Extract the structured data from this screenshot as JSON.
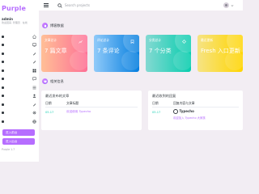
{
  "sidebar": {
    "brand": "Purple",
    "profile": {
      "name": "admin",
      "meta": "欢迎回来, 管理员 · 在线"
    },
    "nav_items": [
      {
        "icon": "home-icon"
      },
      {
        "icon": "monitor-icon"
      },
      {
        "icon": "pen-icon"
      },
      {
        "icon": "pen-icon"
      },
      {
        "icon": "grid-icon"
      },
      {
        "icon": "comment-icon"
      },
      {
        "icon": "list-icon"
      },
      {
        "icon": "user-icon"
      },
      {
        "icon": "pen-icon"
      },
      {
        "icon": "settings-icon"
      },
      {
        "icon": "globe-icon"
      }
    ],
    "button_1": "进入前台",
    "button_2": "进入后台",
    "footer": "Purple 1.7"
  },
  "topbar": {
    "search_placeholder": "Search projects"
  },
  "sections": {
    "first": "博客数据",
    "second": "相关信息"
  },
  "cards": [
    {
      "label": "文章总计",
      "value": "7 篇文章"
    },
    {
      "label": "评论总计",
      "value": "7 条评论"
    },
    {
      "label": "分类总计",
      "value": "7 个分类"
    },
    {
      "label": "最近更新",
      "value": "Fresh 入口更新"
    }
  ],
  "panel_posts": {
    "title": "最近发布的文章",
    "col_date": "日期",
    "col_title": "文章标题",
    "rows": [
      {
        "date": "05.17",
        "title": "欢迎使用 Typecho"
      }
    ]
  },
  "panel_comments": {
    "title": "最近收到的回复",
    "col_date": "日期",
    "col_main": "回复内容与文章",
    "rows": [
      {
        "date": "05.17",
        "logo": "Typecho",
        "body": "欢迎加入 Typecho 大家族"
      }
    ]
  },
  "colors": {
    "accent": "#b66dff",
    "background": "#f2edf3"
  }
}
